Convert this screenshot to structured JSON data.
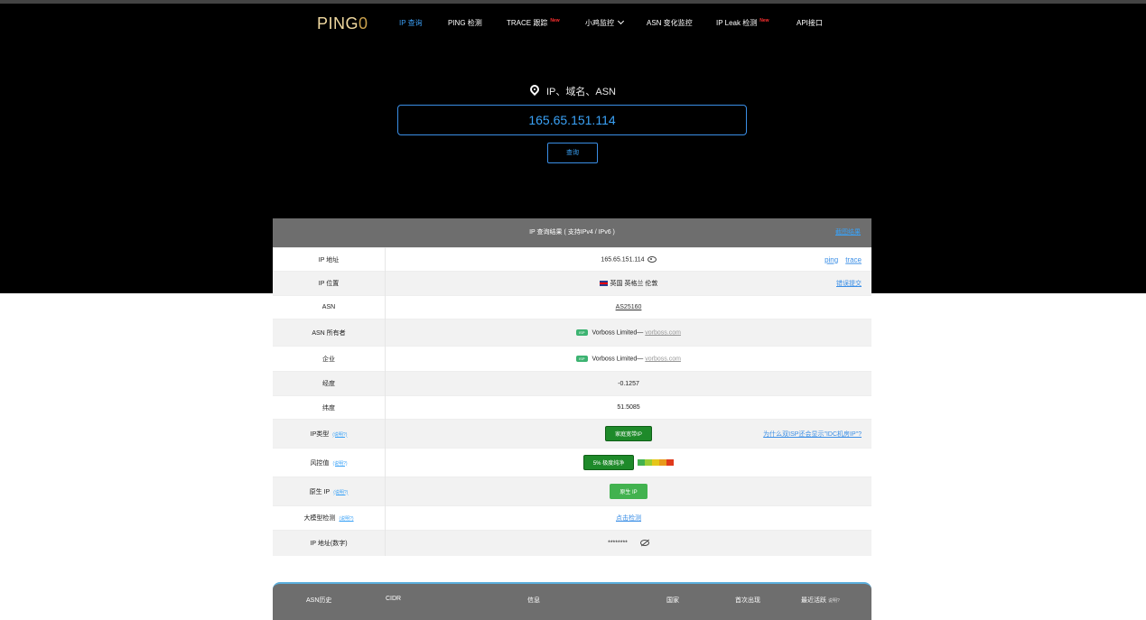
{
  "nav": {
    "logo_main": "PING",
    "logo_zero": "0",
    "items": [
      {
        "label": "IP 查询"
      },
      {
        "label": "PING 检测"
      },
      {
        "label": "TRACE 跟踪",
        "badge": "New"
      },
      {
        "label": "小鸡监控"
      },
      {
        "label": "ASN 变化监控"
      },
      {
        "label": "IP Leak 检测",
        "badge": "New"
      },
      {
        "label": "API接口"
      }
    ]
  },
  "search": {
    "label": "IP、域名、ASN",
    "value": "165.65.151.114",
    "button_label": "查询"
  },
  "result": {
    "title": "IP 查询结果 ( 支持IPv4 / IPv6 )",
    "screenshot_label": "截图结果",
    "rows": [
      {
        "key": "IP 地址",
        "value": "165.65.151.114",
        "links": [
          "ping",
          "trace"
        ]
      },
      {
        "key": "IP 位置",
        "value": "英国 英格兰 伦敦",
        "right": "错误提交"
      },
      {
        "key": "ASN",
        "value": "AS25160"
      },
      {
        "key": "ASN 所有者",
        "badge": "ISP",
        "value": "Vorboss Limited—",
        "domain": "vorboss.com"
      },
      {
        "key": "企业",
        "badge": "ISP",
        "value": "Vorboss Limited—",
        "domain": "vorboss.com"
      },
      {
        "key": "经度",
        "value": "-0.1257"
      },
      {
        "key": "纬度",
        "value": "51.5085"
      },
      {
        "key": "IP类型",
        "note": "(说明?)",
        "value": "家庭宽带IP",
        "right": "为什么双ISP还会显示\"IDC机房IP\"?"
      },
      {
        "key": "风控值",
        "note": "(说明?)",
        "value": "5%  极度纯净"
      },
      {
        "key": "原生 IP",
        "note": "(说明?)",
        "value": "原生 IP"
      },
      {
        "key": "大模型检测",
        "note": "(说明?)",
        "value": "点击检测"
      },
      {
        "key": "IP 地址(数字)",
        "value": "********"
      }
    ]
  },
  "asn_history": {
    "headers": [
      "ASN历史",
      "CIDR",
      "信息",
      "国家",
      "首次出现",
      "最近活跃"
    ],
    "note": "说明?"
  },
  "colors": {
    "accent": "#3aa2f7",
    "risk": [
      "#42b24f",
      "#9acd32",
      "#e6c619",
      "#e89a1c",
      "#e03a1c"
    ]
  }
}
